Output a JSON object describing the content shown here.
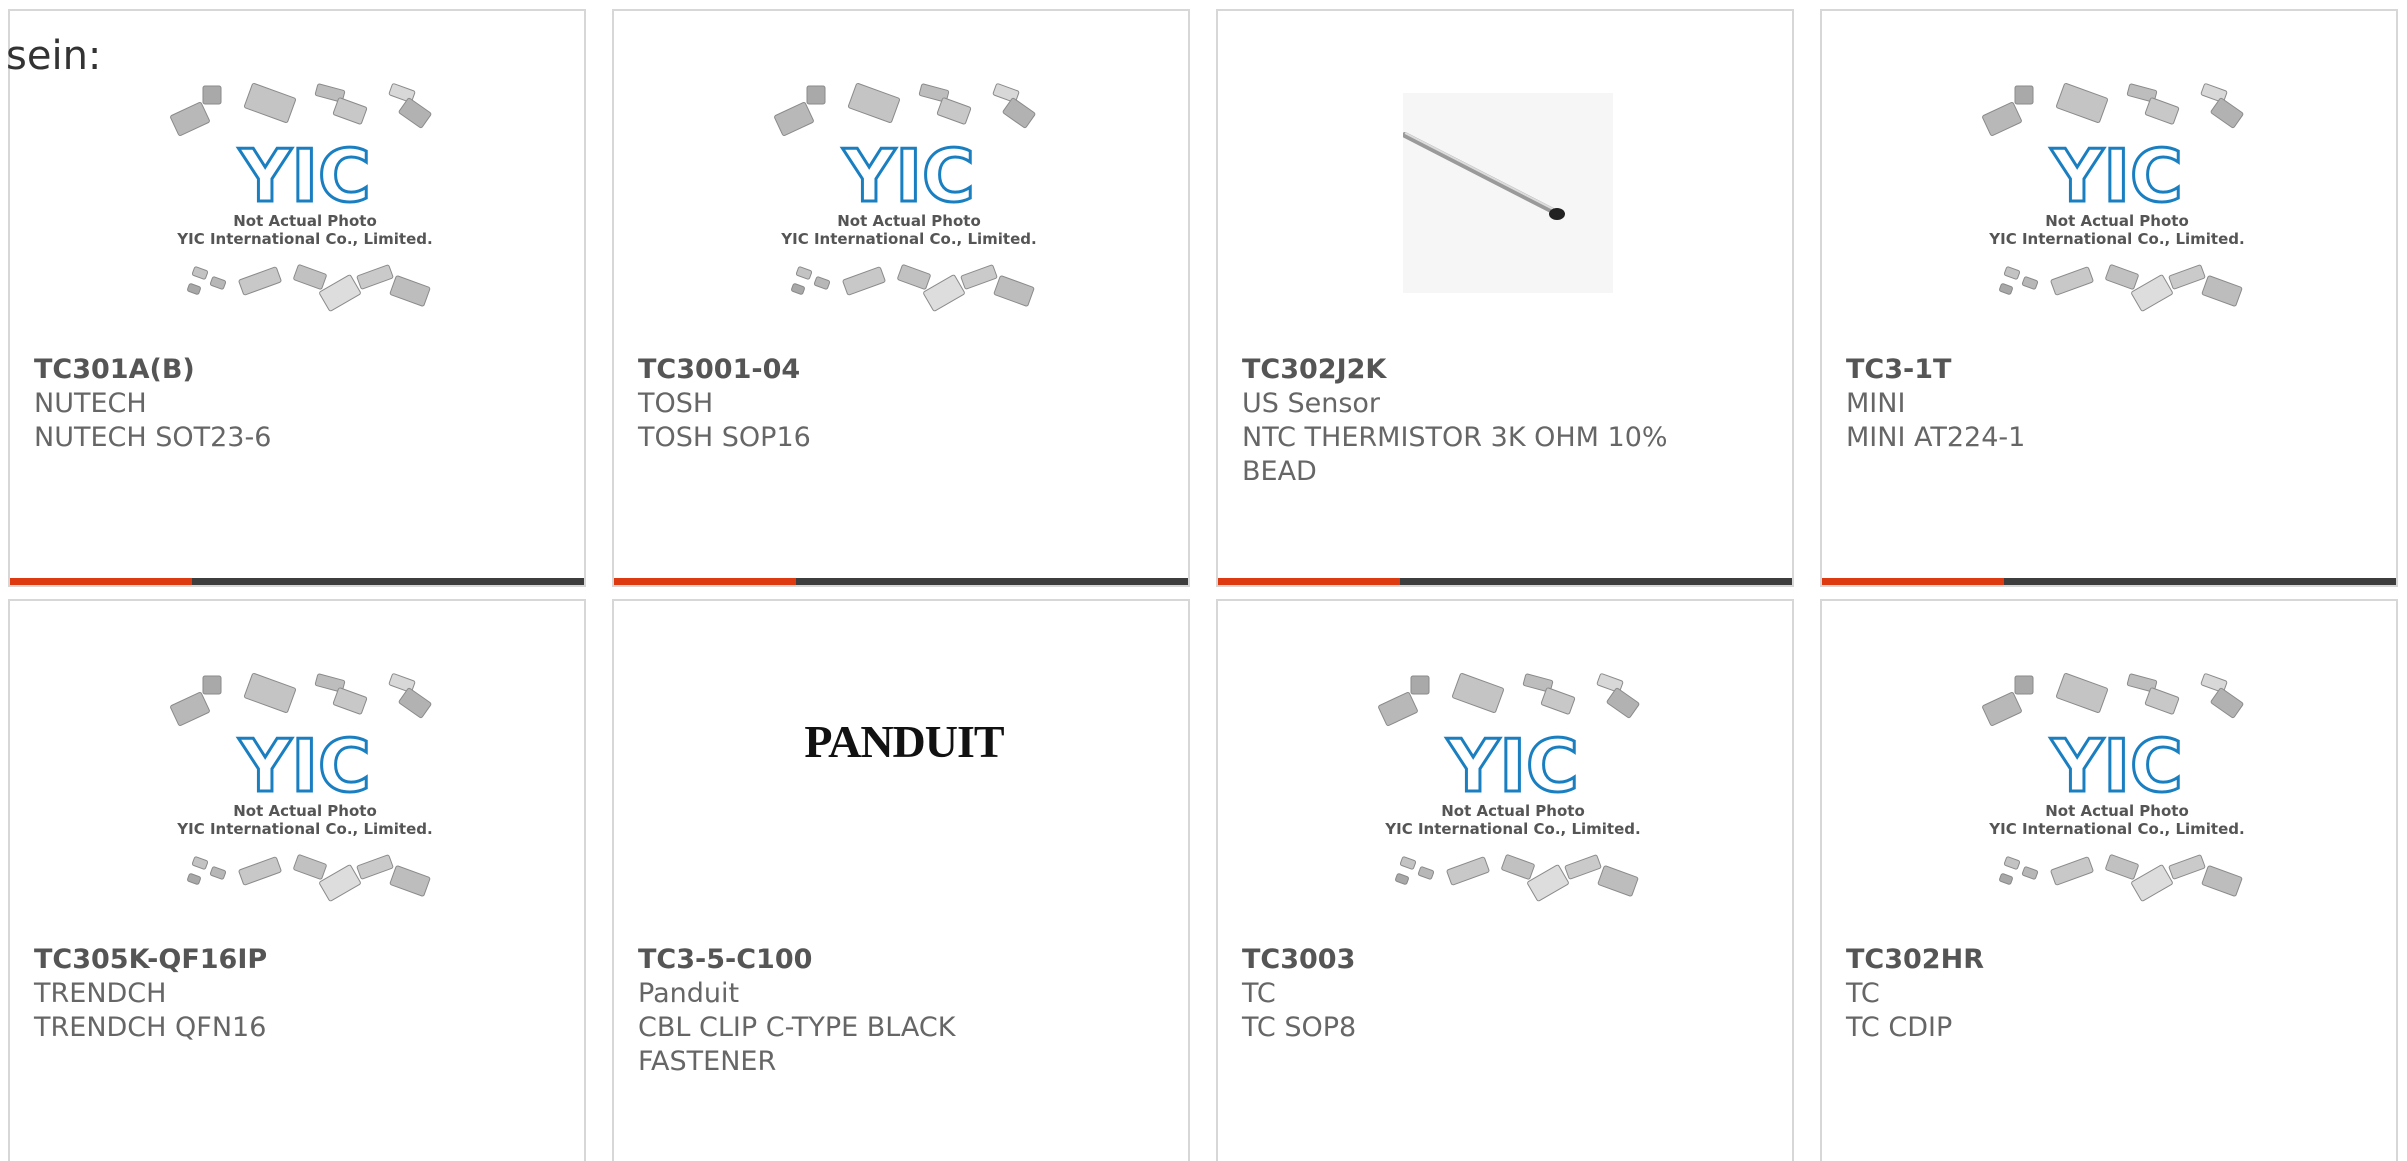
{
  "intro": "sein:",
  "colors": {
    "accent": "#dd3a12",
    "bar": "#3d3d3d",
    "border": "#d7d7d7"
  },
  "placeholder": {
    "line1": "Not Actual Photo",
    "line2": "YIC International Co., Limited.",
    "logo": "YIC"
  },
  "panduit_logo": "PANDUIT",
  "products": [
    {
      "part": "TC301A(B)",
      "brand": "NUTECH",
      "desc": "NUTECH SOT23-6",
      "image": "placeholder"
    },
    {
      "part": "TC3001-04",
      "brand": "TOSH",
      "desc": "TOSH SOP16",
      "image": "placeholder"
    },
    {
      "part": "TC302J2K",
      "brand": "US Sensor",
      "desc": "NTC THERMISTOR 3K OHM 10% BEAD",
      "image": "thermistor-photo"
    },
    {
      "part": "TC3-1T",
      "brand": "MINI",
      "desc": "MINI AT224-1",
      "image": "placeholder"
    },
    {
      "part": "TC305K-QF16IP",
      "brand": "TRENDCH",
      "desc": "TRENDCH QFN16",
      "image": "placeholder"
    },
    {
      "part": "TC3-5-C100",
      "brand": "Panduit",
      "desc": "CBL CLIP C-TYPE BLACK FASTENER",
      "image": "panduit-logo"
    },
    {
      "part": "TC3003",
      "brand": "TC",
      "desc": "TC SOP8",
      "image": "placeholder"
    },
    {
      "part": "TC302HR",
      "brand": "TC",
      "desc": "TC CDIP",
      "image": "placeholder"
    }
  ]
}
